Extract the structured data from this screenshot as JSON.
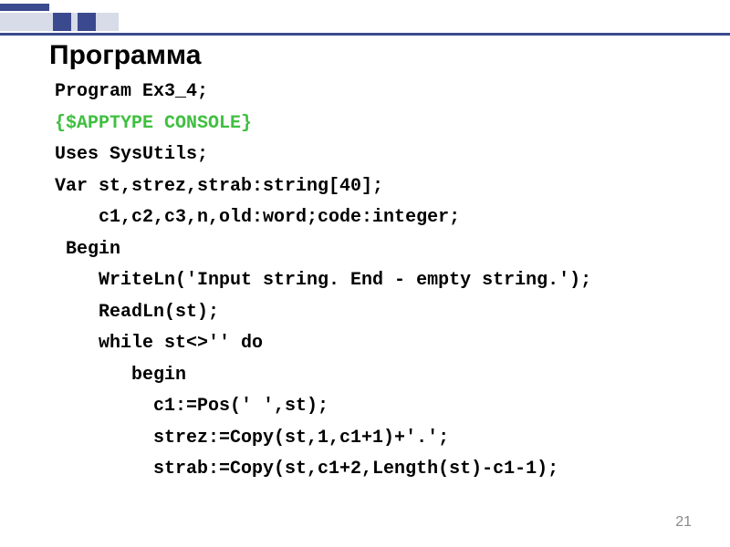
{
  "slide": {
    "title": "Программа",
    "page_number": "21"
  },
  "code": {
    "lines": [
      {
        "indent": 0,
        "text": "Program Ex3_4;",
        "class": ""
      },
      {
        "indent": 0,
        "text": "{$APPTYPE CONSOLE}",
        "class": "directive"
      },
      {
        "indent": 0,
        "text": "Uses SysUtils;",
        "class": ""
      },
      {
        "indent": 0,
        "text": "Var st,strez,strab:string[40];",
        "class": ""
      },
      {
        "indent": 4,
        "text": "c1,c2,c3,n,old:word;code:integer;",
        "class": ""
      },
      {
        "indent": 1,
        "text": "Begin",
        "class": ""
      },
      {
        "indent": 4,
        "text": "WriteLn('Input string. End - empty string.');",
        "class": ""
      },
      {
        "indent": 4,
        "text": "ReadLn(st);",
        "class": ""
      },
      {
        "indent": 4,
        "text": "while st<>'' do",
        "class": ""
      },
      {
        "indent": 7,
        "text": "begin",
        "class": ""
      },
      {
        "indent": 9,
        "text": "c1:=Pos(' ',st);",
        "class": ""
      },
      {
        "indent": 9,
        "text": "strez:=Copy(st,1,c1+1)+'.';",
        "class": ""
      },
      {
        "indent": 9,
        "text": "strab:=Copy(st,c1+2,Length(st)-c1-1);",
        "class": ""
      }
    ]
  }
}
